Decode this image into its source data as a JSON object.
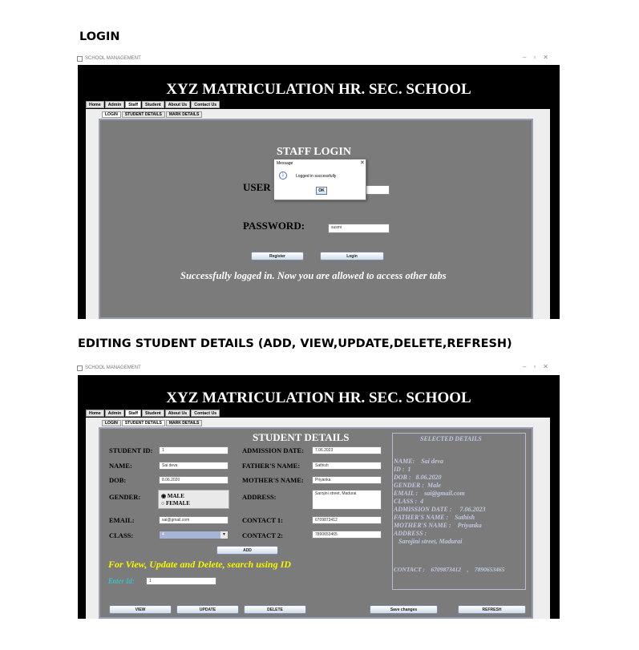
{
  "sections": {
    "login_heading": "LOGIN",
    "editing_heading": "EDITING STUDENT DETAILS (ADD, VIEW,UPDATE,DELETE,REFRESH)"
  },
  "window": {
    "title": "SCHOOL MANAGEMENT",
    "school_name": "XYZ MATRICULATION HR. SEC. SCHOOL",
    "tabs": [
      "Home",
      "Admin",
      "Staff",
      "Student",
      "About Us",
      "Contact Us"
    ],
    "active_tab": "Staff",
    "subtabs": [
      "LOGIN",
      "STUDENT DETAILS",
      "MARK DETAILS"
    ]
  },
  "login_screen": {
    "active_subtab": "LOGIN",
    "heading": "STAFF LOGIN",
    "username_label": "USER",
    "password_label": "PASSWORD:",
    "password_value": "susmi",
    "register_button": "Register",
    "login_button": "Login",
    "status_message": "Successfully logged in. Now you are allowed to access other tabs",
    "dialog": {
      "title": "Message",
      "message": "Logged in successfully",
      "ok_button": "OK"
    }
  },
  "student_screen": {
    "active_subtab": "STUDENT DETAILS",
    "heading": "STUDENT DETAILS",
    "labels": {
      "student_id": "STUDENT ID:",
      "name": "NAME:",
      "dob": "DOB:",
      "gender": "GENDER:",
      "email": "EMAIL:",
      "class": "CLASS:",
      "admission_date": "ADMISSION DATE:",
      "father_name": "FATHER'S NAME:",
      "mother_name": "MOTHER'S NAME:",
      "address": "ADDRESS:",
      "contact1": "CONTACT 1:",
      "contact2": "CONTACT 2:"
    },
    "values": {
      "student_id": "1",
      "name": "Sai deva",
      "dob": "8.06.2020",
      "email": "sai@gmail.com",
      "class": "4",
      "admission_date": "7.06.2023",
      "father_name": "Sathish",
      "mother_name": "Priyanka",
      "address": "Sarojini street, Madurai",
      "contact1": "6709873412",
      "contact2": "7890653465"
    },
    "gender_options": [
      "MALE",
      "FEMALE"
    ],
    "gender_selected": "MALE",
    "add_button": "ADD",
    "search_heading": "For View, Update and Delete, search using ID",
    "enter_id_label": "Enter Id:",
    "enter_id_value": "1",
    "buttons": {
      "view": "VIEW",
      "update": "UPDATE",
      "delete": "DELETE",
      "save": "Save changes",
      "refresh": "REFRESH"
    },
    "selected_details": {
      "heading": "SELECTED DETAILS",
      "lines": [
        "NAME:    Sai deva",
        "ID :  1",
        "DOB :   8.06.2020",
        "GENDER :  Male",
        "EMAIL :    sai@gmail.com",
        "CLASS :  4",
        "ADMISSION DATE :     7.06.2023",
        "FATHER'S NAME :    Sathish",
        "MOTHER'S NAME :    Priyanka",
        "ADDRESS :",
        "   Sarojini street, Madurai",
        "",
        "",
        "CONTACT :    6709873412    ,    7890653465"
      ]
    }
  },
  "colors": {
    "header_black": "#000000",
    "panel_gray": "#7b7b7b",
    "search_heading_yellow": "#f7f700",
    "enter_id_cyan": "#22d8e6",
    "selected_text": "#c2c8e0"
  }
}
